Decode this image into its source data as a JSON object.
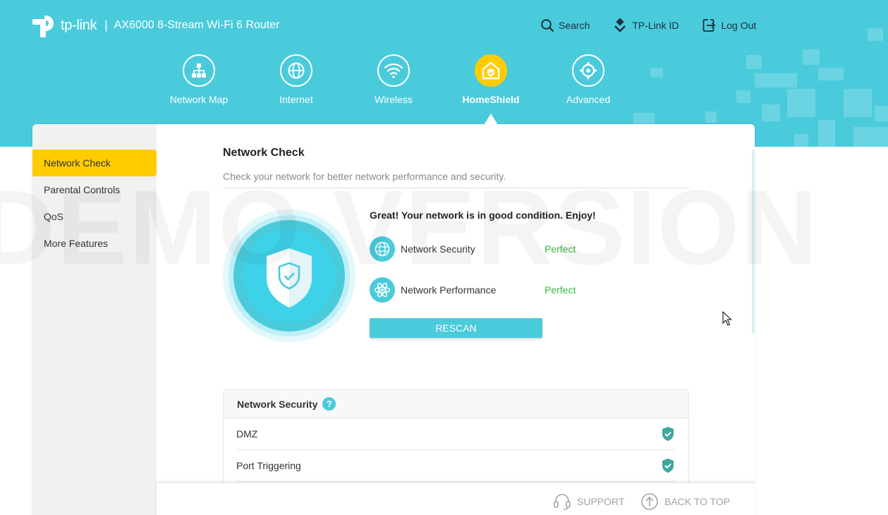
{
  "header": {
    "brand": "tp-link",
    "separator": "|",
    "model": "AX6000 8-Stream Wi-Fi 6 Router",
    "links": [
      {
        "label": "Search",
        "icon": "search-icon"
      },
      {
        "label": "TP-Link ID",
        "icon": "tplink-id-icon"
      },
      {
        "label": "Log Out",
        "icon": "logout-icon"
      }
    ]
  },
  "nav": {
    "items": [
      {
        "label": "Network Map",
        "icon": "network-map-icon"
      },
      {
        "label": "Internet",
        "icon": "globe-icon"
      },
      {
        "label": "Wireless",
        "icon": "wifi-icon"
      },
      {
        "label": "HomeShield",
        "icon": "homeshield-icon",
        "active": true
      },
      {
        "label": "Advanced",
        "icon": "gear-icon"
      }
    ]
  },
  "watermark": "DEMO VERSION",
  "sidebar": {
    "items": [
      {
        "label": "Network Check",
        "active": true
      },
      {
        "label": "Parental Controls"
      },
      {
        "label": "QoS"
      },
      {
        "label": "More Features"
      }
    ]
  },
  "main": {
    "title": "Network Check",
    "subtitle": "Check your network for better network performance and security.",
    "status_message": "Great! Your network is in good condition. Enjoy!",
    "checks": [
      {
        "name": "Network Security",
        "status": "Perfect",
        "icon": "globe-icon"
      },
      {
        "name": "Network Performance",
        "status": "Perfect",
        "icon": "atom-icon"
      }
    ],
    "rescan_label": "RESCAN"
  },
  "security_panel": {
    "title": "Network Security",
    "help": "?",
    "rows": [
      {
        "label": "DMZ",
        "status_icon": "shield-check-icon"
      },
      {
        "label": "Port Triggering",
        "status_icon": "shield-check-icon"
      }
    ]
  },
  "footer": {
    "support_label": "SUPPORT",
    "back_to_top_label": "BACK TO TOP"
  },
  "colors": {
    "accent": "#4acbdc",
    "active": "#ffcc00",
    "ok": "#3cb93c"
  }
}
